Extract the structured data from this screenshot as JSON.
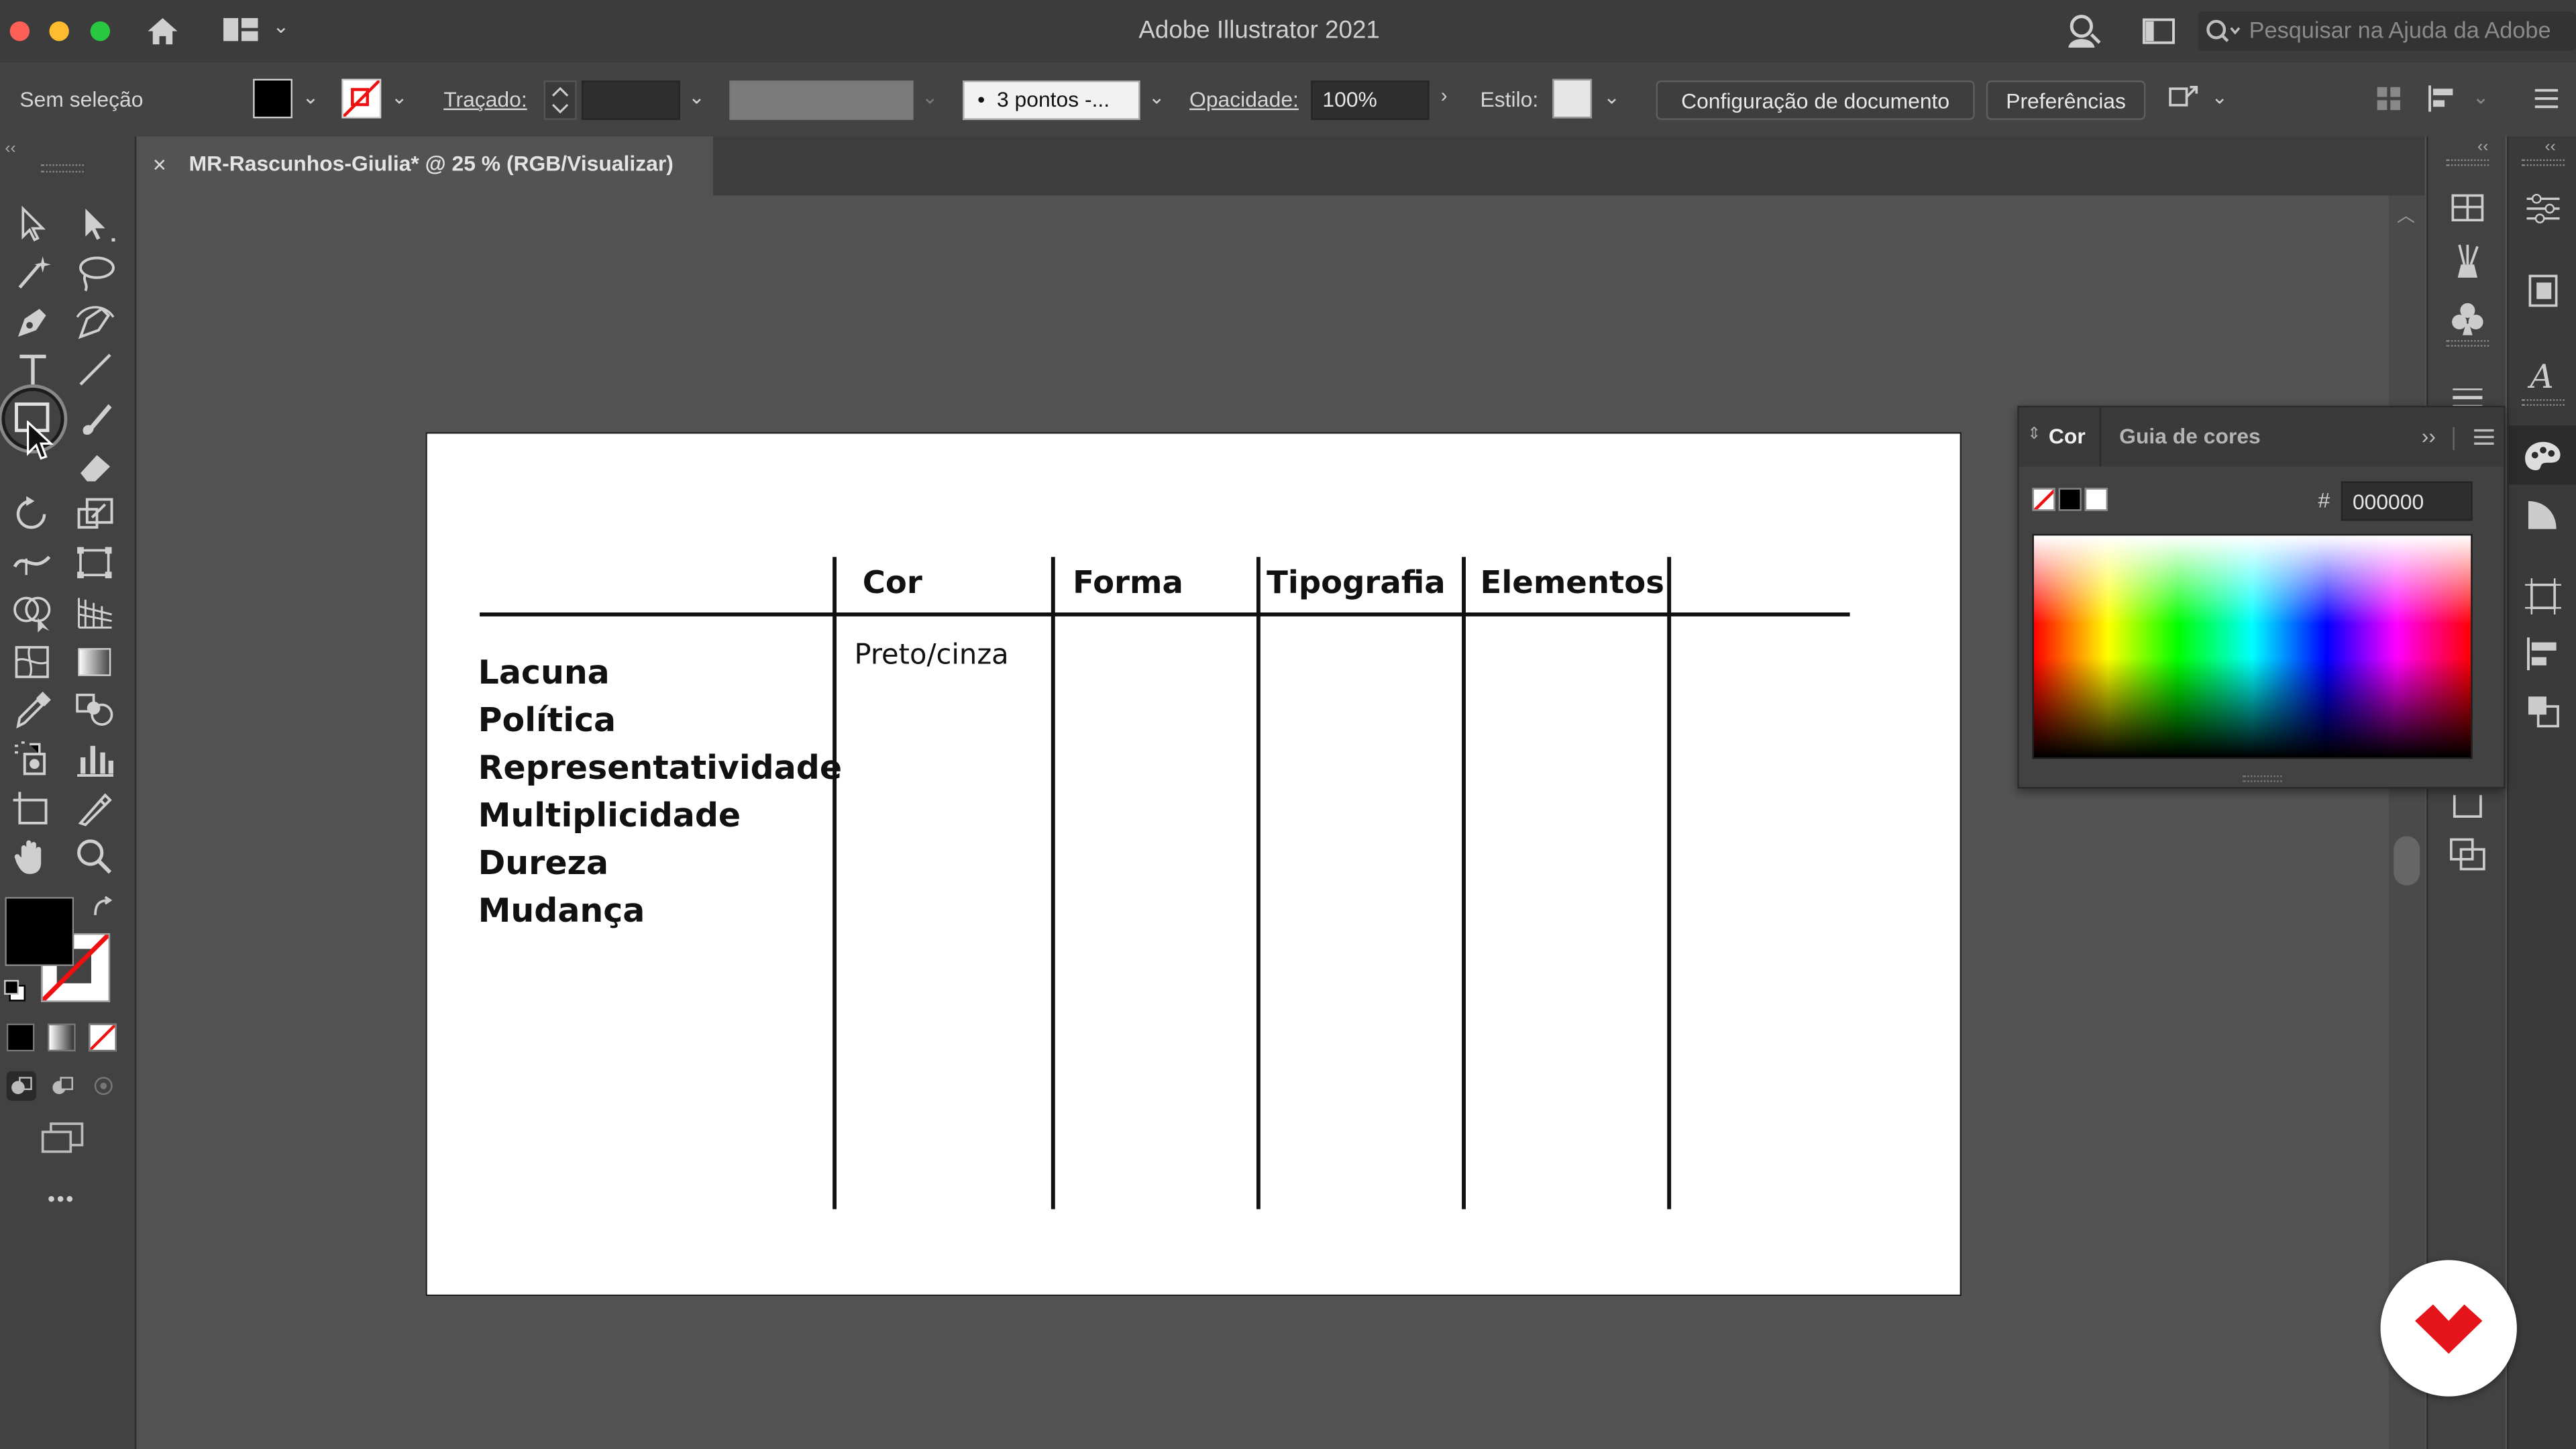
{
  "window": {
    "title": "Adobe Illustrator 2021",
    "search_placeholder": "Pesquisar na Ajuda da Adobe"
  },
  "control_bar": {
    "selection_status": "Sem seleção",
    "stroke_label": "Traçado:",
    "brush_value": "3 pontos -...",
    "opacity_label": "Opacidade:",
    "opacity_value": "100%",
    "style_label": "Estilo:",
    "doc_setup_button": "Configuração de documento",
    "preferences_button": "Preferências"
  },
  "document_tab": {
    "title": "MR-Rascunhos-Giulia* @ 25 % (RGB/Visualizar)",
    "close_glyph": "×"
  },
  "artboard": {
    "columns": [
      "Cor",
      "Forma",
      "Tipografia",
      "Elementos"
    ],
    "rows": [
      "Lacuna",
      "Política",
      "Representatividade",
      "Multiplicidade",
      "Dureza",
      "Mudança"
    ],
    "cell_cor_1": "Preto/cinza"
  },
  "color_panel": {
    "tabs": [
      "Cor",
      "Guia de cores"
    ],
    "hex_label": "#",
    "hex_value": "000000"
  },
  "tools": {
    "more_glyph": "•••"
  },
  "colors": {
    "app_bg": "#535353",
    "panel_bg": "#424242",
    "titlebar_bg": "#3c3c3c",
    "brand_red": "#e5141a"
  }
}
